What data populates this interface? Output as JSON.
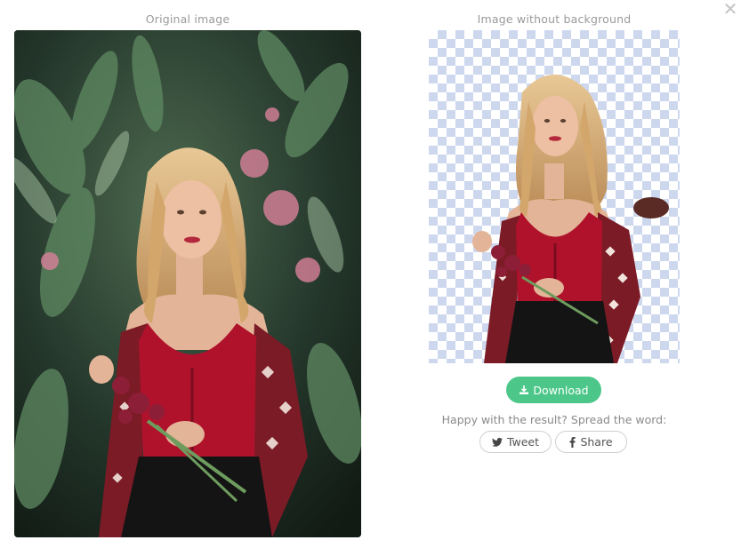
{
  "header": {
    "original_label": "Original image",
    "result_label": "Image without background"
  },
  "close": {
    "icon": "close-icon",
    "glyph": "✕"
  },
  "actions": {
    "download_label": "Download",
    "download_icon": "download-icon",
    "spread_text": "Happy with the result? Spread the word:",
    "tweet_label": "Tweet",
    "tweet_icon": "twitter-icon",
    "share_label": "Share",
    "share_icon": "facebook-icon"
  },
  "colors": {
    "accent": "#4cc789",
    "checker": "#cdd8ef",
    "dress": "#b0122c",
    "hair": "#d9b27a",
    "foliage": "#2f5a39"
  }
}
